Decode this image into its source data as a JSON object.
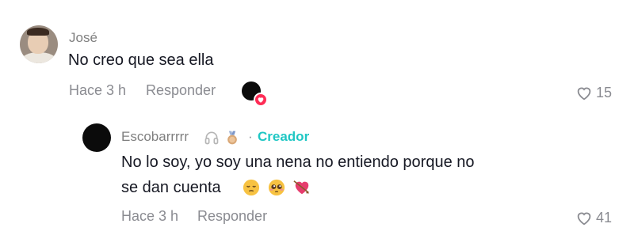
{
  "comment": {
    "username": "José",
    "text": "No creo que sea ella",
    "time": "Hace 3 h",
    "reply_label": "Responder",
    "likes": "15",
    "liked_by_creator": true
  },
  "reply": {
    "username": "Escobarrrrr",
    "badges": [
      "headphones-icon",
      "medal-icon"
    ],
    "separator": "·",
    "creator_label": "Creador",
    "text_line1": "No lo soy, yo soy una nena no entiendo porque no",
    "text_line2": "se dan cuenta",
    "emojis": [
      "pensive-face-emoji",
      "pleading-face-emoji",
      "heart-with-arrow-emoji"
    ],
    "time": "Hace 3 h",
    "reply_label": "Responder",
    "likes": "41"
  },
  "colors": {
    "accent_creator": "#20c7c4",
    "like_badge": "#fe2c55",
    "text_primary": "#161823",
    "text_secondary": "#8a8b91"
  }
}
